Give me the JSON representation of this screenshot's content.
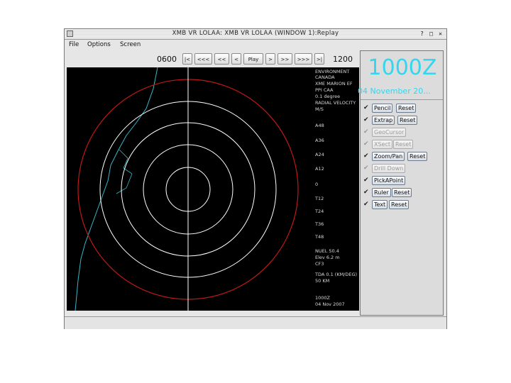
{
  "window": {
    "title": "XMB VR LOLAA: XMB VR LOLAA (WINDOW 1):Replay",
    "buttons": [
      "?",
      "□",
      "✕"
    ]
  },
  "menu": [
    "File",
    "Options",
    "Screen"
  ],
  "navigation": {
    "start_time": "0600",
    "end_time": "1200",
    "buttons": [
      "|<",
      "<<<",
      "<<",
      "<",
      "Play",
      ">",
      ">>",
      ">>>",
      ">|"
    ]
  },
  "sidepanel": {
    "time": "1000Z",
    "date": "04 November 20...",
    "tools": [
      {
        "label": "Pencil",
        "reset": "Reset",
        "enabled": true
      },
      {
        "label": "Extrap",
        "reset": "Reset",
        "enabled": true
      },
      {
        "label": "GeoCursor",
        "reset": "",
        "enabled": false
      },
      {
        "label": "XSect",
        "reset": "Reset",
        "enabled": false
      },
      {
        "label": "Zoom/Pan",
        "reset": "Reset",
        "enabled": true
      },
      {
        "label": "Drill Down",
        "reset": "",
        "enabled": false
      },
      {
        "label": "PickAPoint",
        "reset": "",
        "enabled": true
      },
      {
        "label": "Ruler",
        "reset": "Reset",
        "enabled": true
      },
      {
        "label": "Text",
        "reset": "Reset",
        "enabled": true
      }
    ]
  },
  "radar": {
    "header_lines": [
      "ENVIRONMENT",
      "CANADA",
      "XME MARION EF",
      "PPI CAA",
      "0.1 degree",
      "RADIAL VELOCITY",
      "M/S"
    ],
    "legend_labels": [
      "A48",
      "A36",
      "A24",
      "A12",
      "0",
      "T12",
      "T24",
      "T36",
      "T48"
    ],
    "legend_colors": [
      "#f0a0c0",
      "#d8c8a8",
      "#f0e040",
      "#f0a020",
      "#ff6020",
      "#ff2ca0",
      "#e050e0",
      "#8040d0",
      "#40c8ff",
      "#30a0ff",
      "#20c040",
      "#10a020",
      "#d0d0d0",
      "#b0a8d0"
    ],
    "footer_lines": [
      "NUEL 50.4",
      "Elev 6.2 m",
      "CF3",
      "",
      "TDA 0.1 (KM/DEG)",
      "50 KM"
    ],
    "bottom_time": "1000Z",
    "bottom_date": "04 Nov 2007"
  }
}
